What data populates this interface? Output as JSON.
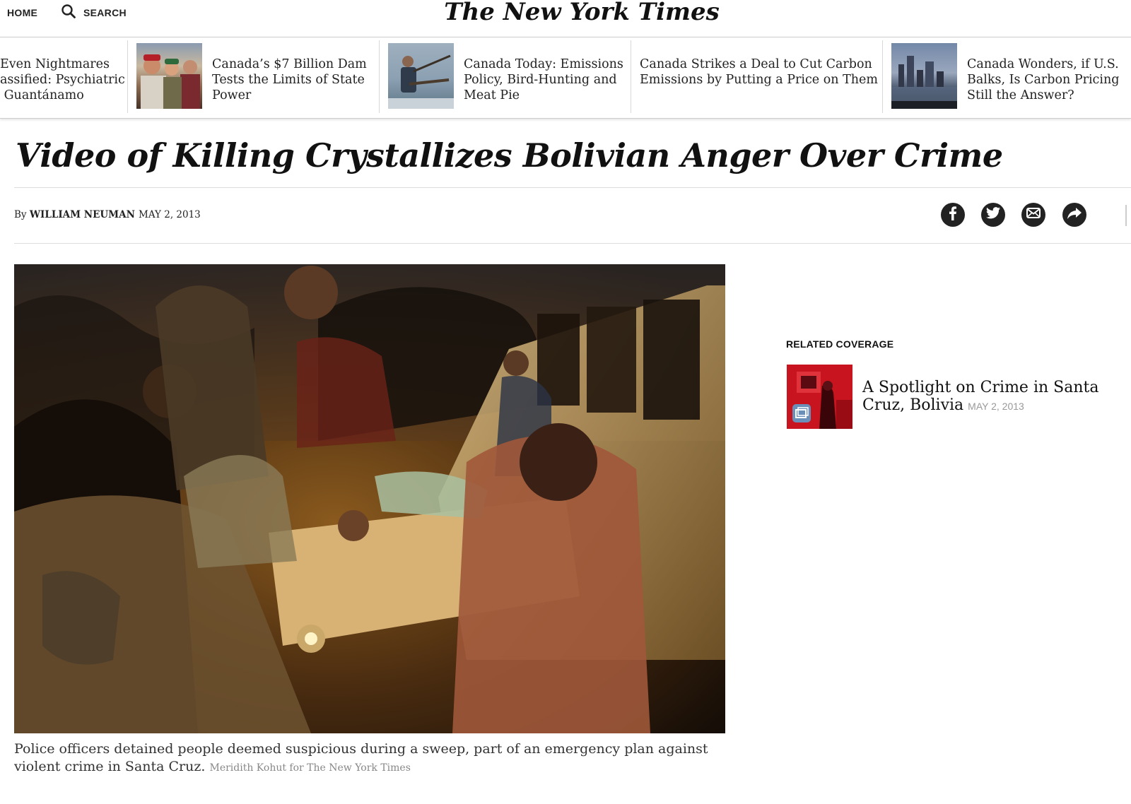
{
  "header": {
    "home_label": "HOME",
    "search_label": "SEARCH",
    "logo_text": "The New York Times"
  },
  "carousel": {
    "items": [
      {
        "headline": "Even Nightmares\nassified: Psychiatric\n Guantánamo",
        "has_thumb": false
      },
      {
        "headline": "Canada’s $7 Billion Dam\nTests the Limits of State\nPower",
        "has_thumb": true
      },
      {
        "headline": "Canada Today: Emissions\nPolicy, Bird-Hunting and\nMeat Pie",
        "has_thumb": true
      },
      {
        "headline": "Canada Strikes a Deal to Cut Carbon\nEmissions by Putting a Price on Them",
        "has_thumb": false
      },
      {
        "headline": "Canada Wonders, if U.S.\nBalks, Is Carbon Pricing\nStill the Answer?",
        "has_thumb": true
      }
    ]
  },
  "article": {
    "headline": "Video of Killing Crystallizes Bolivian Anger Over Crime",
    "byline_prefix": "By",
    "author": "WILLIAM NEUMAN",
    "date": "MAY 2, 2013",
    "share_icons": [
      "facebook-icon",
      "twitter-icon",
      "email-icon",
      "share-arrow-icon"
    ],
    "caption": "Police officers detained people deemed suspicious during a sweep, part of an emergency plan against violent crime in Santa Cruz.",
    "credit": "Meridith Kohut for The New York Times"
  },
  "related": {
    "heading": "RELATED COVERAGE",
    "title": "A Spotlight on Crime in Santa Cruz, Bolivia",
    "date": "MAY 2, 2013"
  },
  "colors": {
    "text": "#121212",
    "rule": "#dddddd",
    "share_circle": "#222222",
    "meta_gray": "#999999"
  }
}
